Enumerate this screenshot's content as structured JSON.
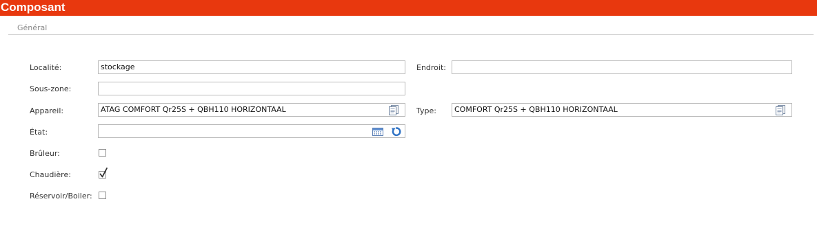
{
  "window": {
    "title": "Composant"
  },
  "tabs": [
    {
      "label": "Général"
    }
  ],
  "form": {
    "localite": {
      "label": "Localité:",
      "value": "stockage"
    },
    "endroit": {
      "label": "Endroit:",
      "value": ""
    },
    "sous_zone": {
      "label": "Sous-zone:",
      "value": ""
    },
    "appareil": {
      "label": "Appareil:",
      "value": "ATAG COMFORT Qr25S + QBH110 HORIZONTAAL",
      "icon": "document-lookup-icon"
    },
    "type": {
      "label": "Type:",
      "value": "COMFORT Qr25S + QBH110 HORIZONTAAL",
      "icon": "document-lookup-icon"
    },
    "etat": {
      "label": "État:",
      "value": "",
      "icons": [
        "calendar-icon",
        "refresh-icon"
      ]
    },
    "bruleur": {
      "label": "Brûleur:",
      "checked": false
    },
    "chaudiere": {
      "label": "Chaudière:",
      "checked": true
    },
    "reservoir": {
      "label": "Réservoir/Boiler:",
      "checked": false
    }
  },
  "colors": {
    "titlebar": "#e8380e",
    "border": "#b9b9b9",
    "tab_text": "#8a8a8a"
  }
}
